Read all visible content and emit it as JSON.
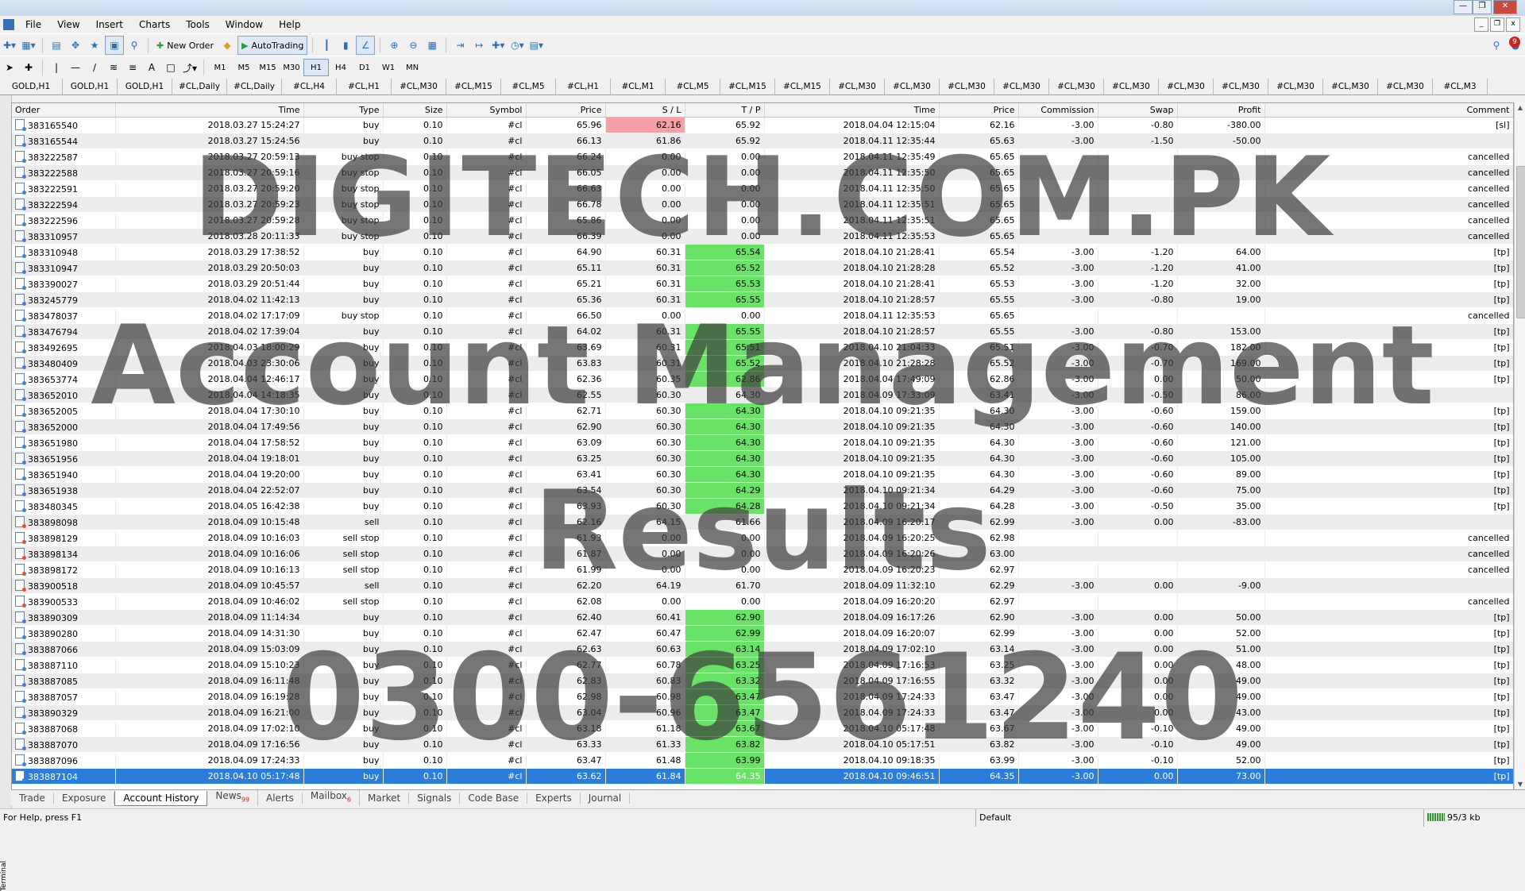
{
  "menu": [
    "File",
    "View",
    "Insert",
    "Charts",
    "Tools",
    "Window",
    "Help"
  ],
  "toolbar": {
    "new_order": "New Order",
    "autotrading": "AutoTrading",
    "notifications": "9"
  },
  "timeframes": [
    "M1",
    "M5",
    "M15",
    "M30",
    "H1",
    "H4",
    "D1",
    "W1",
    "MN"
  ],
  "chart_tabs": [
    "GOLD,H1",
    "GOLD,H1",
    "GOLD,H1",
    "#CL,Daily",
    "#CL,Daily",
    "#CL,H4",
    "#CL,H1",
    "#CL,M30",
    "#CL,M15",
    "#CL,M5",
    "#CL,H1",
    "#CL,M1",
    "#CL,M5",
    "#CL,M15",
    "#CL,M15",
    "#CL,M30",
    "#CL,M30",
    "#CL,M30",
    "#CL,M30",
    "#CL,M30",
    "#CL,M30",
    "#CL,M30",
    "#CL,M30",
    "#CL,M30",
    "#CL,M30",
    "#CL,M30",
    "#CL,M3"
  ],
  "columns": [
    "Order",
    "Time",
    "Type",
    "Size",
    "Symbol",
    "Price",
    "S / L",
    "T / P",
    "Time",
    "Price",
    "Commission",
    "Swap",
    "Profit",
    "Comment"
  ],
  "rows": [
    [
      "383165540",
      "2018.03.27 15:24:27",
      "buy",
      "0.10",
      "#cl",
      "65.96",
      "62.16",
      "65.92",
      "2018.04.04 12:15:04",
      "62.16",
      "-3.00",
      "-0.80",
      "-380.00",
      "[sl]"
    ],
    [
      "383165544",
      "2018.03.27 15:24:56",
      "buy",
      "0.10",
      "#cl",
      "66.13",
      "61.86",
      "65.92",
      "2018.04.11 12:35:44",
      "65.63",
      "-3.00",
      "-1.50",
      "-50.00",
      ""
    ],
    [
      "383222587",
      "2018.03.27 20:59:13",
      "buy stop",
      "0.10",
      "#cl",
      "66.24",
      "0.00",
      "0.00",
      "2018.04.11 12:35:49",
      "65.65",
      "",
      "",
      "",
      "cancelled"
    ],
    [
      "383222588",
      "2018.03.27 20:59:16",
      "buy stop",
      "0.10",
      "#cl",
      "66.05",
      "0.00",
      "0.00",
      "2018.04.11 12:35:50",
      "65.65",
      "",
      "",
      "",
      "cancelled"
    ],
    [
      "383222591",
      "2018.03.27 20:59:20",
      "buy stop",
      "0.10",
      "#cl",
      "66.63",
      "0.00",
      "0.00",
      "2018.04.11 12:35:50",
      "65.65",
      "",
      "",
      "",
      "cancelled"
    ],
    [
      "383222594",
      "2018.03.27 20:59:23",
      "buy stop",
      "0.10",
      "#cl",
      "66.78",
      "0.00",
      "0.00",
      "2018.04.11 12:35:51",
      "65.65",
      "",
      "",
      "",
      "cancelled"
    ],
    [
      "383222596",
      "2018.03.27 20:59:28",
      "buy stop",
      "0.10",
      "#cl",
      "65.86",
      "0.00",
      "0.00",
      "2018.04.11 12:35:51",
      "65.65",
      "",
      "",
      "",
      "cancelled"
    ],
    [
      "383310957",
      "2018.03.28 20:11:33",
      "buy stop",
      "0.10",
      "#cl",
      "66.39",
      "0.00",
      "0.00",
      "2018.04.11 12:35:53",
      "65.65",
      "",
      "",
      "",
      "cancelled"
    ],
    [
      "383310948",
      "2018.03.29 17:38:52",
      "buy",
      "0.10",
      "#cl",
      "64.90",
      "60.31",
      "65.54",
      "2018.04.10 21:28:41",
      "65.54",
      "-3.00",
      "-1.20",
      "64.00",
      "[tp]"
    ],
    [
      "383310947",
      "2018.03.29 20:50:03",
      "buy",
      "0.10",
      "#cl",
      "65.11",
      "60.31",
      "65.52",
      "2018.04.10 21:28:28",
      "65.52",
      "-3.00",
      "-1.20",
      "41.00",
      "[tp]"
    ],
    [
      "383390027",
      "2018.03.29 20:51:44",
      "buy",
      "0.10",
      "#cl",
      "65.21",
      "60.31",
      "65.53",
      "2018.04.10 21:28:41",
      "65.53",
      "-3.00",
      "-1.20",
      "32.00",
      "[tp]"
    ],
    [
      "383245779",
      "2018.04.02 11:42:13",
      "buy",
      "0.10",
      "#cl",
      "65.36",
      "60.31",
      "65.55",
      "2018.04.10 21:28:57",
      "65.55",
      "-3.00",
      "-0.80",
      "19.00",
      "[tp]"
    ],
    [
      "383478037",
      "2018.04.02 17:17:09",
      "buy stop",
      "0.10",
      "#cl",
      "66.50",
      "0.00",
      "0.00",
      "2018.04.11 12:35:53",
      "65.65",
      "",
      "",
      "",
      "cancelled"
    ],
    [
      "383476794",
      "2018.04.02 17:39:04",
      "buy",
      "0.10",
      "#cl",
      "64.02",
      "60.31",
      "65.55",
      "2018.04.10 21:28:57",
      "65.55",
      "-3.00",
      "-0.80",
      "153.00",
      "[tp]"
    ],
    [
      "383492695",
      "2018.04.03 18:00:29",
      "buy",
      "0.10",
      "#cl",
      "63.69",
      "60.31",
      "65.51",
      "2018.04.10 21:04:33",
      "65.51",
      "-3.00",
      "-0.70",
      "182.00",
      "[tp]"
    ],
    [
      "383480409",
      "2018.04.03 23:30:06",
      "buy",
      "0.10",
      "#cl",
      "63.83",
      "60.31",
      "65.52",
      "2018.04.10 21:28:28",
      "65.52",
      "-3.00",
      "-0.70",
      "169.00",
      "[tp]"
    ],
    [
      "383653774",
      "2018.04.04 12:46:17",
      "buy",
      "0.10",
      "#cl",
      "62.36",
      "60.35",
      "62.86",
      "2018.04.04 17:49:09",
      "62.86",
      "-3.00",
      "0.00",
      "50.00",
      "[tp]"
    ],
    [
      "383652010",
      "2018.04.04 14:18:35",
      "buy",
      "0.10",
      "#cl",
      "62.55",
      "60.30",
      "64.30",
      "2018.04.09 17:33:09",
      "63.41",
      "-3.00",
      "-0.50",
      "86.00",
      ""
    ],
    [
      "383652005",
      "2018.04.04 17:30:10",
      "buy",
      "0.10",
      "#cl",
      "62.71",
      "60.30",
      "64.30",
      "2018.04.10 09:21:35",
      "64.30",
      "-3.00",
      "-0.60",
      "159.00",
      "[tp]"
    ],
    [
      "383652000",
      "2018.04.04 17:49:56",
      "buy",
      "0.10",
      "#cl",
      "62.90",
      "60.30",
      "64.30",
      "2018.04.10 09:21:35",
      "64.30",
      "-3.00",
      "-0.60",
      "140.00",
      "[tp]"
    ],
    [
      "383651980",
      "2018.04.04 17:58:52",
      "buy",
      "0.10",
      "#cl",
      "63.09",
      "60.30",
      "64.30",
      "2018.04.10 09:21:35",
      "64.30",
      "-3.00",
      "-0.60",
      "121.00",
      "[tp]"
    ],
    [
      "383651956",
      "2018.04.04 19:18:01",
      "buy",
      "0.10",
      "#cl",
      "63.25",
      "60.30",
      "64.30",
      "2018.04.10 09:21:35",
      "64.30",
      "-3.00",
      "-0.60",
      "105.00",
      "[tp]"
    ],
    [
      "383651940",
      "2018.04.04 19:20:00",
      "buy",
      "0.10",
      "#cl",
      "63.41",
      "60.30",
      "64.30",
      "2018.04.10 09:21:35",
      "64.30",
      "-3.00",
      "-0.60",
      "89.00",
      "[tp]"
    ],
    [
      "383651938",
      "2018.04.04 22:52:07",
      "buy",
      "0.10",
      "#cl",
      "63.54",
      "60.30",
      "64.29",
      "2018.04.10 09:21:34",
      "64.29",
      "-3.00",
      "-0.60",
      "75.00",
      "[tp]"
    ],
    [
      "383480345",
      "2018.04.05 16:42:38",
      "buy",
      "0.10",
      "#cl",
      "63.93",
      "60.30",
      "64.28",
      "2018.04.10 09:21:34",
      "64.28",
      "-3.00",
      "-0.50",
      "35.00",
      "[tp]"
    ],
    [
      "383898098",
      "2018.04.09 10:15:48",
      "sell",
      "0.10",
      "#cl",
      "62.16",
      "64.15",
      "61.66",
      "2018.04.09 16:20:17",
      "62.99",
      "-3.00",
      "0.00",
      "-83.00",
      ""
    ],
    [
      "383898129",
      "2018.04.09 10:16:03",
      "sell stop",
      "0.10",
      "#cl",
      "61.93",
      "0.00",
      "0.00",
      "2018.04.09 16:20:25",
      "62.98",
      "",
      "",
      "",
      "cancelled"
    ],
    [
      "383898134",
      "2018.04.09 10:16:06",
      "sell stop",
      "0.10",
      "#cl",
      "61.87",
      "0.00",
      "0.00",
      "2018.04.09 16:20:26",
      "63.00",
      "",
      "",
      "",
      "cancelled"
    ],
    [
      "383898172",
      "2018.04.09 10:16:13",
      "sell stop",
      "0.10",
      "#cl",
      "61.99",
      "0.00",
      "0.00",
      "2018.04.09 16:20:23",
      "62.97",
      "",
      "",
      "",
      "cancelled"
    ],
    [
      "383900518",
      "2018.04.09 10:45:57",
      "sell",
      "0.10",
      "#cl",
      "62.20",
      "64.19",
      "61.70",
      "2018.04.09 11:32:10",
      "62.29",
      "-3.00",
      "0.00",
      "-9.00",
      ""
    ],
    [
      "383900533",
      "2018.04.09 10:46:02",
      "sell stop",
      "0.10",
      "#cl",
      "62.08",
      "0.00",
      "0.00",
      "2018.04.09 16:20:20",
      "62.97",
      "",
      "",
      "",
      "cancelled"
    ],
    [
      "383890309",
      "2018.04.09 11:14:34",
      "buy",
      "0.10",
      "#cl",
      "62.40",
      "60.41",
      "62.90",
      "2018.04.09 16:17:26",
      "62.90",
      "-3.00",
      "0.00",
      "50.00",
      "[tp]"
    ],
    [
      "383890280",
      "2018.04.09 14:31:30",
      "buy",
      "0.10",
      "#cl",
      "62.47",
      "60.47",
      "62.99",
      "2018.04.09 16:20:07",
      "62.99",
      "-3.00",
      "0.00",
      "52.00",
      "[tp]"
    ],
    [
      "383887066",
      "2018.04.09 15:03:09",
      "buy",
      "0.10",
      "#cl",
      "62.63",
      "60.63",
      "63.14",
      "2018.04.09 17:02:10",
      "63.14",
      "-3.00",
      "0.00",
      "51.00",
      "[tp]"
    ],
    [
      "383887110",
      "2018.04.09 15:10:23",
      "buy",
      "0.10",
      "#cl",
      "62.77",
      "60.78",
      "63.25",
      "2018.04.09 17:16:53",
      "63.25",
      "-3.00",
      "0.00",
      "48.00",
      "[tp]"
    ],
    [
      "383887085",
      "2018.04.09 16:11:48",
      "buy",
      "0.10",
      "#cl",
      "62.83",
      "60.83",
      "63.32",
      "2018.04.09 17:16:55",
      "63.32",
      "-3.00",
      "0.00",
      "49.00",
      "[tp]"
    ],
    [
      "383887057",
      "2018.04.09 16:19:28",
      "buy",
      "0.10",
      "#cl",
      "62.98",
      "60.98",
      "63.47",
      "2018.04.09 17:24:33",
      "63.47",
      "-3.00",
      "0.00",
      "49.00",
      "[tp]"
    ],
    [
      "383890329",
      "2018.04.09 16:21:00",
      "buy",
      "0.10",
      "#cl",
      "63.04",
      "60.96",
      "63.47",
      "2018.04.09 17:24:33",
      "63.47",
      "-3.00",
      "0.00",
      "43.00",
      "[tp]"
    ],
    [
      "383887068",
      "2018.04.09 17:02:10",
      "buy",
      "0.10",
      "#cl",
      "63.18",
      "61.18",
      "63.67",
      "2018.04.10 05:17:48",
      "63.67",
      "-3.00",
      "-0.10",
      "49.00",
      "[tp]"
    ],
    [
      "383887070",
      "2018.04.09 17:16:56",
      "buy",
      "0.10",
      "#cl",
      "63.33",
      "61.33",
      "63.82",
      "2018.04.10 05:17:51",
      "63.82",
      "-3.00",
      "-0.10",
      "49.00",
      "[tp]"
    ],
    [
      "383887096",
      "2018.04.09 17:24:33",
      "buy",
      "0.10",
      "#cl",
      "63.47",
      "61.48",
      "63.99",
      "2018.04.10 09:18:35",
      "63.99",
      "-3.00",
      "-0.10",
      "52.00",
      "[tp]"
    ],
    [
      "383887104",
      "2018.04.10 05:17:48",
      "buy",
      "0.10",
      "#cl",
      "63.62",
      "61.84",
      "64.35",
      "2018.04.10 09:46:51",
      "64.35",
      "-3.00",
      "0.00",
      "73.00",
      "[tp]"
    ]
  ],
  "bottom_tabs": [
    {
      "label": "Trade",
      "badge": ""
    },
    {
      "label": "Exposure",
      "badge": ""
    },
    {
      "label": "Account History",
      "badge": ""
    },
    {
      "label": "News",
      "badge": "99"
    },
    {
      "label": "Alerts",
      "badge": ""
    },
    {
      "label": "Mailbox",
      "badge": "6"
    },
    {
      "label": "Market",
      "badge": ""
    },
    {
      "label": "Signals",
      "badge": ""
    },
    {
      "label": "Code Base",
      "badge": ""
    },
    {
      "label": "Experts",
      "badge": ""
    },
    {
      "label": "Journal",
      "badge": ""
    }
  ],
  "terminal_label": "Terminal",
  "status": {
    "help": "For Help, press F1",
    "profile": "Default",
    "traffic": "95/3 kb"
  },
  "watermark": [
    "DIGITECH.COM.PK",
    "Account Management",
    "Results",
    "0300-6561240"
  ]
}
